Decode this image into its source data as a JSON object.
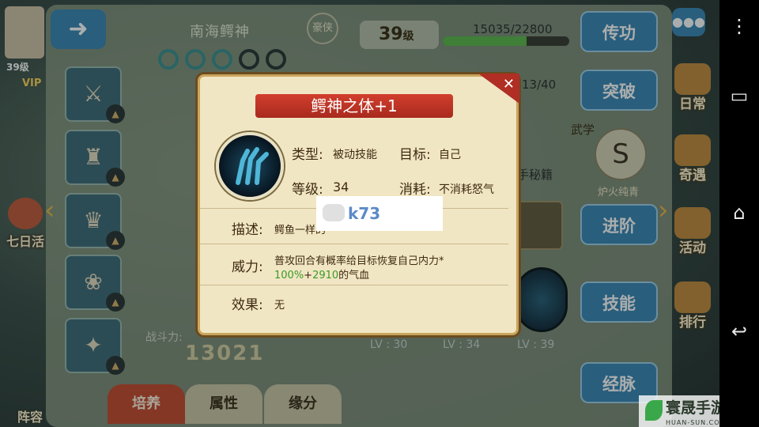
{
  "hero": {
    "name": "南海鳄神",
    "stamp": "豪侠",
    "level": "39",
    "level_suffix": "级",
    "exp_text": "15035/22800",
    "exp_fraction": 0.66,
    "progress2": "13/40",
    "power_label": "战斗力:",
    "power_value": "13021",
    "wu_label": "武学",
    "skill_name_small": "炉火纯青",
    "manual_label": "手秘籍"
  },
  "side_buttons": [
    "传功",
    "突破",
    "进阶",
    "技能",
    "经脉"
  ],
  "bottom_tabs": [
    {
      "label": "培养",
      "active": true
    },
    {
      "label": "属性",
      "active": false
    },
    {
      "label": "缘分",
      "active": false
    }
  ],
  "lv_labels": [
    "LV : 30",
    "LV : 34",
    "LV : 39"
  ],
  "right_icons": [
    "日常",
    "奇遇",
    "活动",
    "排行"
  ],
  "left_icons": [
    "七日活"
  ],
  "bottom_left_label": "阵容",
  "player": {
    "level": "39级",
    "vip": "VIP"
  },
  "popup": {
    "title": "鳄神之体+1",
    "type_label": "类型:",
    "type_value": "被动技能",
    "target_label": "目标:",
    "target_value": "自己",
    "grade_label": "等级:",
    "grade_value": "34",
    "cost_label": "消耗:",
    "cost_value": "不消耗怒气",
    "desc_label": "描述:",
    "desc_value": "鳄鱼一样的",
    "power_label": "威力:",
    "power_line1": "普攻回合有概率给目标恢复自己内力*",
    "power_pct": "100%",
    "power_plus": "+",
    "power_num": "2910",
    "power_suffix": "的气血",
    "effect_label": "效果:",
    "effect_value": "无"
  },
  "watermark": "k73",
  "site_logo": {
    "name": "寰晟手游网",
    "sub": "HUAN-SUN.COM"
  },
  "colors": {
    "accent_blue": "#3b86b6",
    "title_red": "#c74a2f",
    "popup_bg": "#f1e6c3",
    "green": "#3a9a2a"
  },
  "icons": {
    "back": "back-arrow-icon",
    "close": "close-icon",
    "chat": "chat-icon",
    "nav_back": "android-back-icon",
    "nav_home": "android-home-icon",
    "nav_recent": "android-recent-icon"
  }
}
